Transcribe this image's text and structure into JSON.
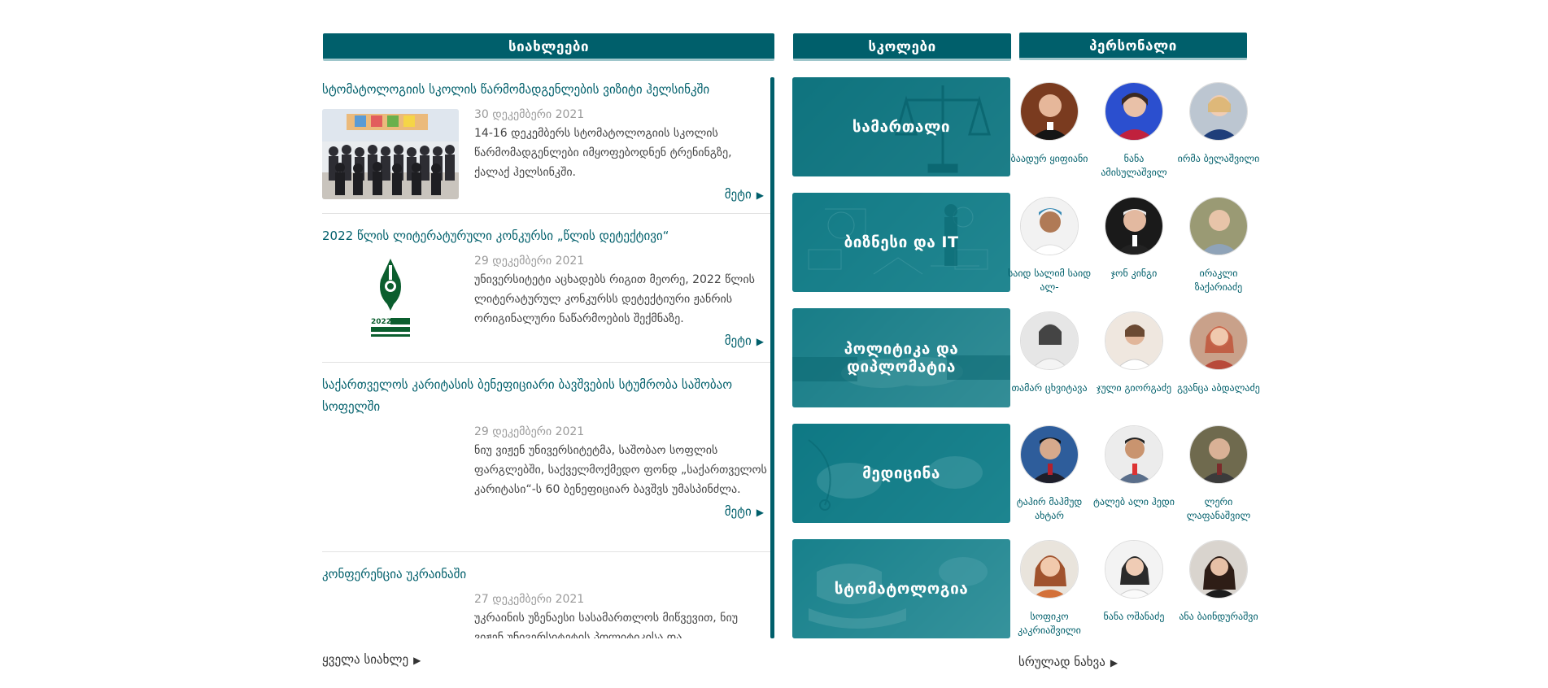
{
  "news": {
    "header": "სიახლეები",
    "more_label": "მეტი",
    "all_label": "ყველა სიახლე",
    "items": [
      {
        "title": "სტომატოლოგიის სკოლის წარმომადგენლების ვიზიტი ჰელსინკში",
        "date": "30 დეკემბერი 2021",
        "text": "14-16 დეკემბერს სტომატოლოგიის სკოლის წარმომადგენლები იმყოფებოდნენ ტრენინგზე, ქალაქ ჰელსინკში."
      },
      {
        "title": "2022 წლის ლიტერატურული კონკურსი „წლის დეტექტივი“",
        "date": "29 დეკემბერი 2021",
        "text": "უნივერსიტეტი აცხადებს რიგით მეორე, 2022 წლის ლიტერატურულ კონკურსს დეტექტიური ჟანრის ორიგინალური ნაწარმოების შექმნაზე."
      },
      {
        "title": "საქართველოს კარიტასის ბენეფიციარი ბავშვების სტუმრობა საშობაო სოფელში",
        "date": "29 დეკემბერი 2021",
        "text": "ნიუ ვიჟენ უნივერსიტეტმა, საშობაო სოფლის ფარგლებში, საქველმოქმედო ფონდ „საქართველოს კარიტასი“-ს 60 ბენეფიციარ ბავშვს უმასპინძლა."
      },
      {
        "title": "კონფერენცია უკრაინაში",
        "date": "27 დეკემბერი 2021",
        "text": "უკრაინის უზენაესი სასამართლოს მიწვევით, ნიუ ვიჟენ უნივერსიტეტის პოლიტიკისა და"
      }
    ]
  },
  "schools": {
    "header": "სკოლები",
    "items": [
      {
        "label": "სამართალი"
      },
      {
        "label": "ბიზნესი და IT"
      },
      {
        "label": "პოლიტიკა და დიპლომატია"
      },
      {
        "label": "მედიცინა"
      },
      {
        "label": "სტომატოლოგია"
      }
    ]
  },
  "staff": {
    "header": "პერსონალი",
    "all_label": "სრულად ნახვა",
    "people": [
      {
        "name": "ბაადურ ყიფიანი"
      },
      {
        "name": "ნანა ამისულაშვილ"
      },
      {
        "name": "ირმა ბელაშვილი"
      },
      {
        "name": "საიდ სალიმ საიდ ალ-"
      },
      {
        "name": "ჯონ კინგი"
      },
      {
        "name": "ირაკლი ზაქარიაძე"
      },
      {
        "name": "თამარ ცხვიტავა"
      },
      {
        "name": "ჯული გიორგაძე"
      },
      {
        "name": "გვანცა აბდალაძე"
      },
      {
        "name": "ტაჰირ მაჰმუდ ახტარ"
      },
      {
        "name": "ტალებ ალი ჰედი"
      },
      {
        "name": "ლერი ლაფანაშვილ"
      },
      {
        "name": "სოფიკო კაკრიაშვილი"
      },
      {
        "name": "ნანა ოშანაძე"
      },
      {
        "name": "ანა ბაინდურაშვი"
      }
    ]
  },
  "colors": {
    "brand": "#005f6b",
    "link": "#005f6b",
    "muted": "#9a9a9a"
  }
}
